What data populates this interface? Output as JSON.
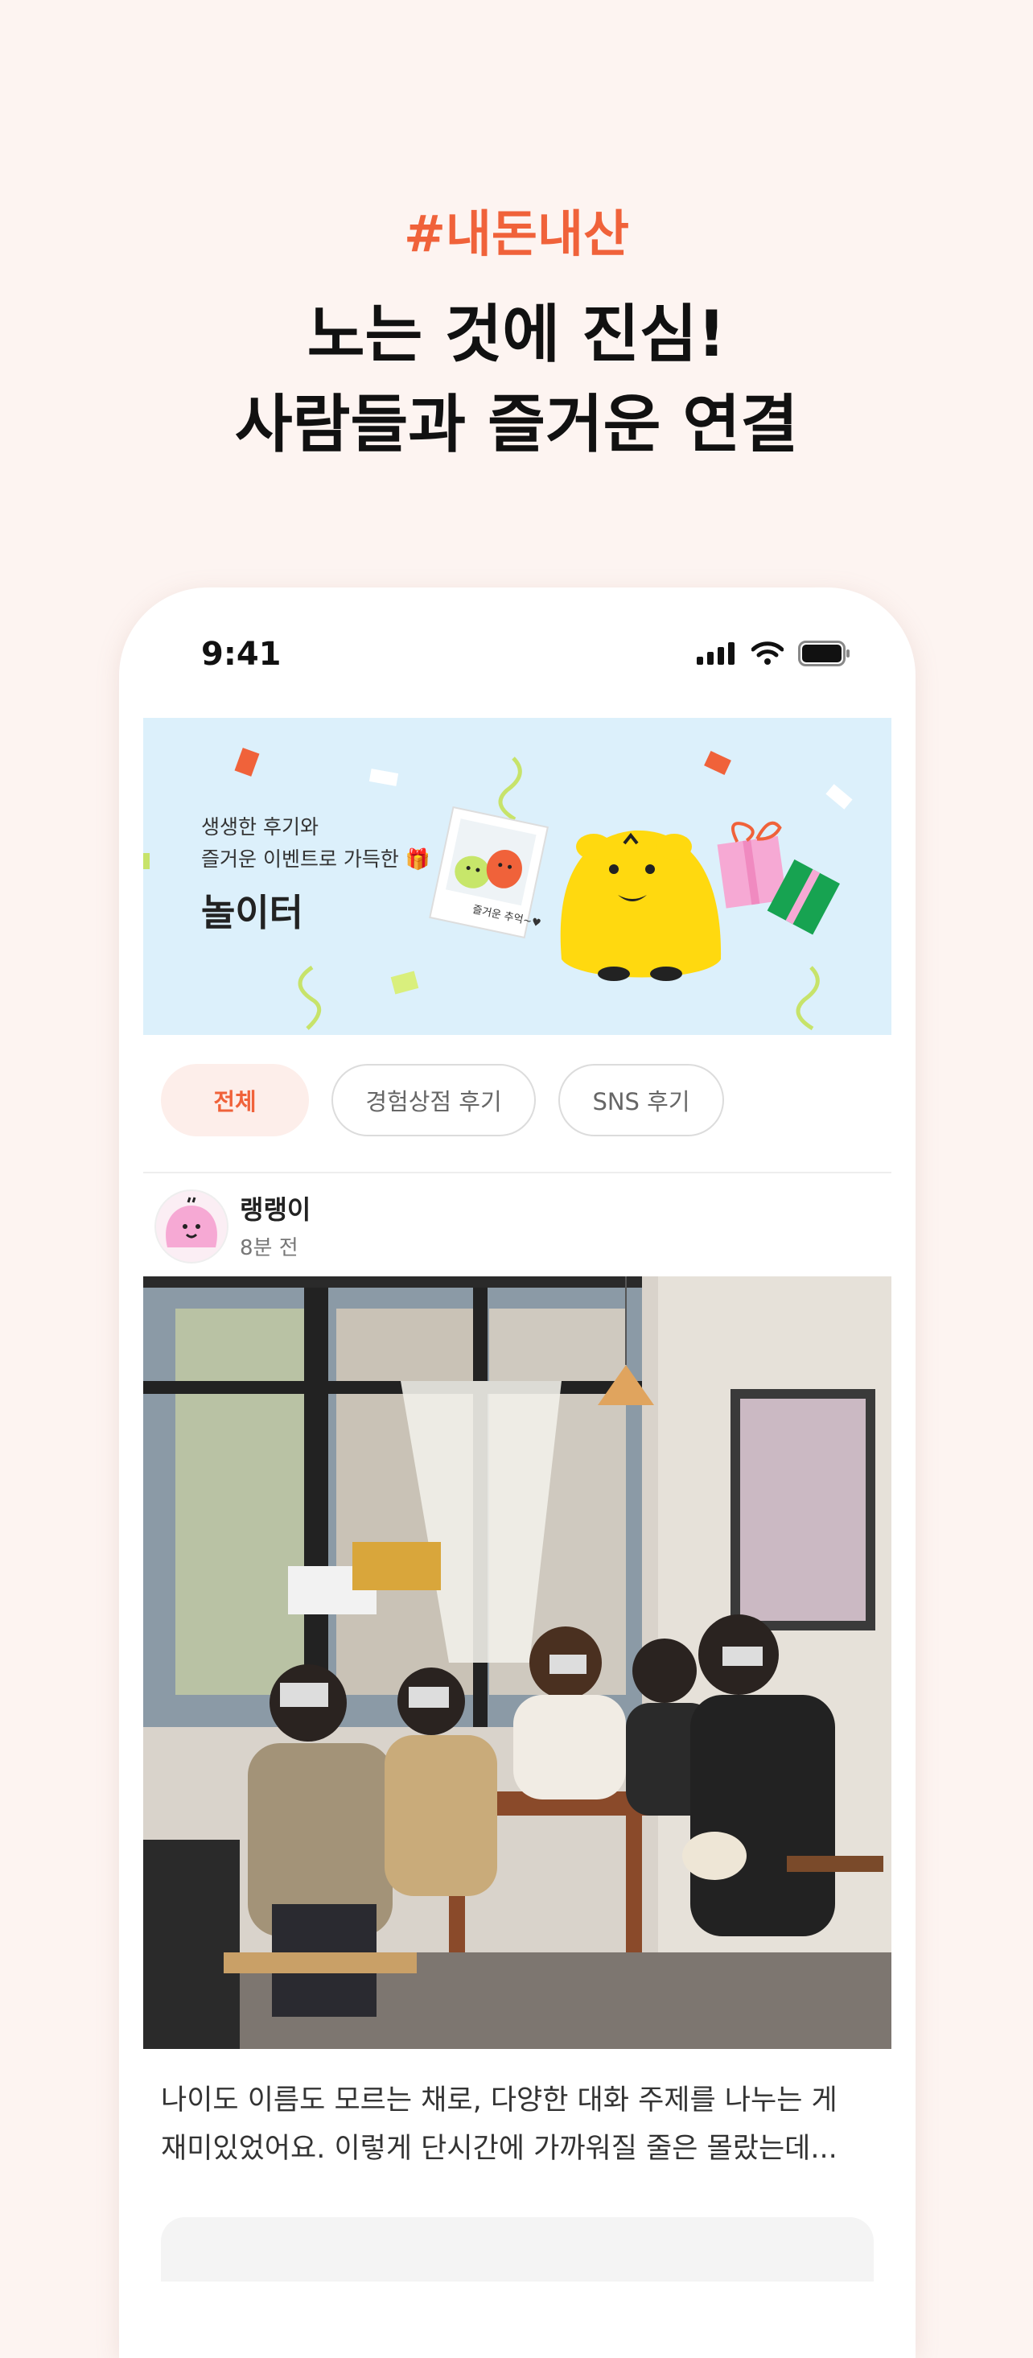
{
  "promo": {
    "hashtag": "#내돈내산",
    "headline_line1": "노는 것에 진심!",
    "headline_line2": "사람들과 즐거운 연결"
  },
  "status_bar": {
    "time": "9:41"
  },
  "banner": {
    "subtitle_line1": "생생한 후기와",
    "subtitle_line2": "즐거운 이벤트로 가득한 🎁",
    "title": "놀이터",
    "polaroid_caption": "즐거운 추억~♥"
  },
  "tabs": [
    {
      "label": "전체",
      "active": true
    },
    {
      "label": "경험상점 후기",
      "active": false
    },
    {
      "label": "SNS 후기",
      "active": false
    }
  ],
  "post": {
    "author": "랭랭이",
    "time_ago": "8분 전",
    "text_line1": "나이도 이름도 모르는 채로, 다양한 대화 주제를 나누는 게",
    "text_line2": "재미있었어요. 이렇게 단시간에 가까워질 줄은 몰랐는데..."
  },
  "colors": {
    "accent": "#f0623a",
    "banner_bg": "#dcf0fb",
    "page_bg": "#fdf4f1"
  }
}
